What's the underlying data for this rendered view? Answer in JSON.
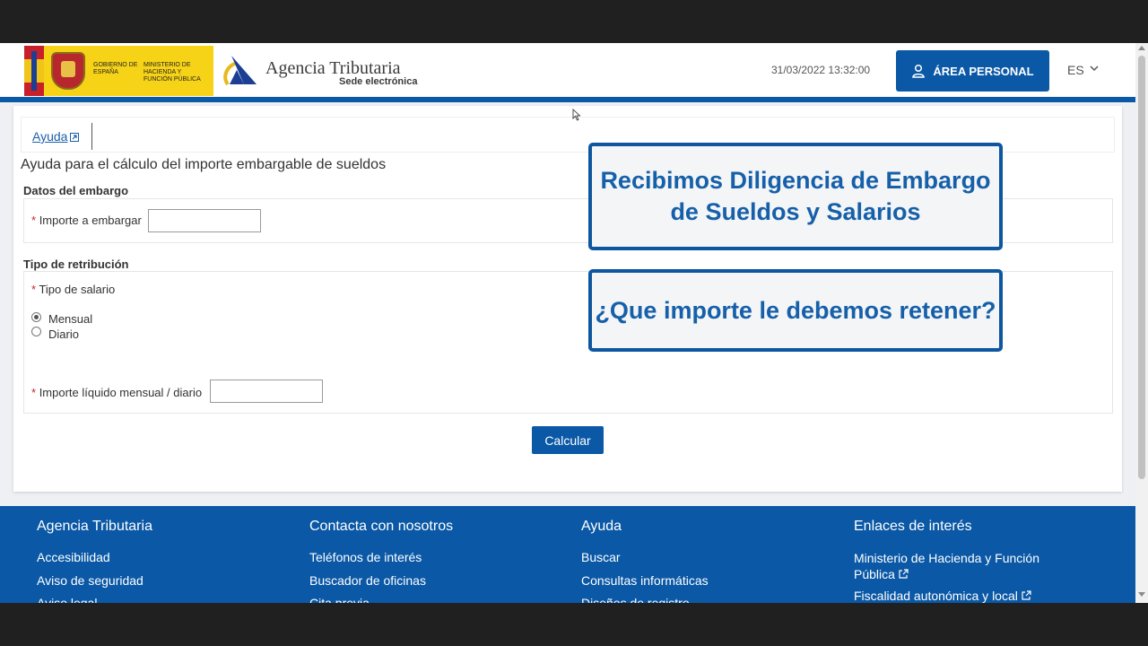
{
  "header": {
    "gov_text_1": "GOBIERNO DE ESPAÑA",
    "gov_text_2": "MINISTERIO DE HACIENDA Y FUNCIÓN PÚBLICA",
    "agency_title": "Agencia Tributaria",
    "agency_subtitle": "Sede electrónica",
    "datetime": "31/03/2022 13:32:00",
    "area_personal_label": "ÁREA PERSONAL",
    "language": "ES"
  },
  "help": {
    "link_label": "Ayuda"
  },
  "form": {
    "title": "Ayuda para el cálculo del importe embargable de sueldos",
    "section1_title": "Datos del embargo",
    "importe_label": "Importe a embargar",
    "importe_value": "",
    "section2_title": "Tipo de retribución",
    "tipo_salario_label": "Tipo de salario",
    "radio_mensual": "Mensual",
    "radio_diario": "Diario",
    "selected_option": "Mensual",
    "liquido_label": "Importe líquido mensual / diario",
    "liquido_value": "",
    "required_mark": "*",
    "calc_button": "Calcular"
  },
  "callouts": {
    "first": "Recibimos Diligencia de Embargo de Sueldos y Salarios",
    "second": "¿Que importe le debemos retener?"
  },
  "footer": {
    "col1": {
      "heading": "Agencia Tributaria",
      "links": [
        "Accesibilidad",
        "Aviso de seguridad",
        "Aviso legal"
      ]
    },
    "col2": {
      "heading": "Contacta con nosotros",
      "links": [
        "Teléfonos de interés",
        "Buscador de oficinas",
        "Cita previa"
      ]
    },
    "col3": {
      "heading": "Ayuda",
      "links": [
        "Buscar",
        "Consultas informáticas",
        "Diseños de registro"
      ]
    },
    "col4": {
      "heading": "Enlaces de interés",
      "links": [
        "Ministerio de Hacienda y Función Pública",
        "Fiscalidad autonómica y local"
      ]
    }
  },
  "colors": {
    "brand_blue": "#0a58a6",
    "callout_text": "#1660a9",
    "required_red": "#c9252b"
  }
}
